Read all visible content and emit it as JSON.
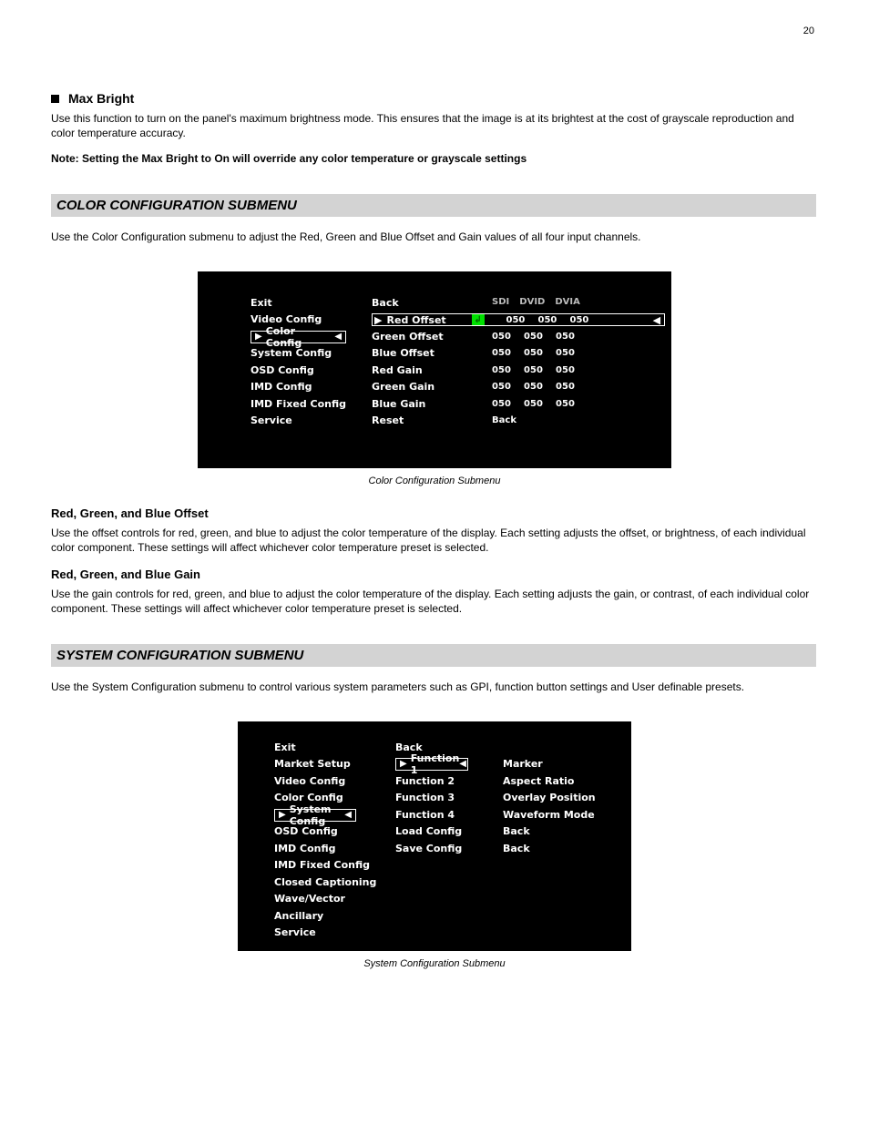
{
  "page_number": "20",
  "max_bright": {
    "heading": "Max Bright",
    "text": "Use this function to turn on the panel's maximum brightness mode. This ensures that the image is at its brightest at the cost of grayscale reproduction and color temperature accuracy."
  },
  "note": "Note: Setting the Max Bright to On will override any color temperature or grayscale settings",
  "color_section": {
    "title": "COLOR CONFIGURATION SUBMENU",
    "intro": "Use the Color Configuration submenu to adjust the Red, Green and Blue Offset and Gain values of all four input channels.",
    "caption": "Color Configuration Submenu",
    "left_menu": [
      "Exit",
      "Video Config",
      "Color Config",
      "System Config",
      "OSD Config",
      "IMD Config",
      "IMD Fixed Config",
      "Service"
    ],
    "mid_menu": [
      "Back",
      "Red Offset",
      "Green Offset",
      "Blue Offset",
      "Red Gain",
      "Green Gain",
      "Blue Gain",
      "Reset"
    ],
    "value_header": [
      "SDI",
      "DVID",
      "DVIA"
    ],
    "value_rows": [
      [
        "050",
        "050",
        "050"
      ],
      [
        "050",
        "050",
        "050"
      ],
      [
        "050",
        "050",
        "050"
      ],
      [
        "050",
        "050",
        "050"
      ],
      [
        "050",
        "050",
        "050"
      ],
      [
        "050",
        "050",
        "050"
      ]
    ],
    "reset_value": "Back",
    "offset_heading": "Red, Green, and Blue Offset",
    "offset_text": "Use the offset controls for red, green, and blue to adjust the color temperature of the display. Each setting adjusts the offset, or brightness, of each individual color component. These settings will affect whichever color temperature preset is selected.",
    "gain_heading": "Red, Green, and Blue Gain",
    "gain_text": "Use the gain controls for red, green, and blue to adjust the color temperature of the display. Each setting adjusts the gain, or contrast, of each individual color component. These settings will affect whichever color temperature preset is selected."
  },
  "system_section": {
    "title": "SYSTEM CONFIGURATION SUBMENU",
    "intro": "Use the System Configuration submenu to control various system parameters such as GPI, function button settings and User definable presets.",
    "caption": "System Configuration Submenu",
    "left_menu": [
      "Exit",
      "Market Setup",
      "Video Config",
      "Color Config",
      "System Config",
      "OSD Config",
      "IMD Config",
      "IMD Fixed Config",
      "Closed Captioning",
      "Wave/Vector",
      "Ancillary",
      "Service"
    ],
    "mid_menu": [
      "Back",
      "Function 1",
      "Function 2",
      "Function 3",
      "Function 4",
      "Load Config",
      "Save Config"
    ],
    "right_menu": [
      "Marker",
      "Aspect Ratio",
      "Overlay Position",
      "Waveform Mode",
      "Back",
      "Back"
    ]
  }
}
